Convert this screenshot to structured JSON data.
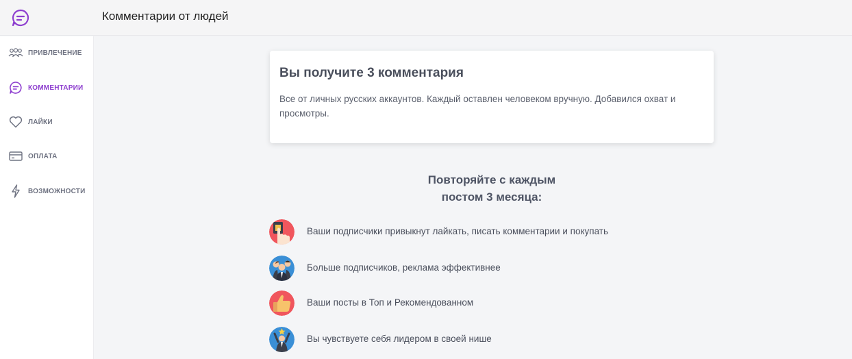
{
  "header": {
    "title": "Комментарии от людей"
  },
  "sidebar": {
    "items": [
      {
        "label": "ПРИВЛЕЧЕНИЕ",
        "icon": "users-icon"
      },
      {
        "label": "КОММЕНТАРИИ",
        "icon": "chat-bubble-icon",
        "active": true
      },
      {
        "label": "ЛАЙКИ",
        "icon": "heart-icon"
      },
      {
        "label": "ОПЛАТА",
        "icon": "credit-card-icon"
      },
      {
        "label": "ВОЗМОЖНОСТИ",
        "icon": "lightning-icon"
      }
    ]
  },
  "card": {
    "title": "Вы получите 3 комментария",
    "text": "Все от личных русских аккаунтов. Каждый оставлен человеком вручную. Добавился охват и просмотры."
  },
  "section": {
    "title_line1": "Повторяйте с каждым",
    "title_line2": "постом 3 месяца:"
  },
  "benefits": [
    {
      "text": "Ваши подписчики привыкнут лайкать, писать комментарии и покупать",
      "icon": "hand-tap-icon"
    },
    {
      "text": "Больше подписчиков, реклама эффективнее",
      "icon": "people-group-icon"
    },
    {
      "text": "Ваши посты в Топ и Рекомендованном",
      "icon": "thumbs-up-icon"
    },
    {
      "text": "Вы чувствуете себя лидером в своей нише",
      "icon": "leader-icon"
    }
  ],
  "colors": {
    "accent": "#8e3fcf",
    "nav_text": "#6f7382",
    "icon_red": "#f0565d",
    "icon_blue": "#3a8fd6"
  }
}
